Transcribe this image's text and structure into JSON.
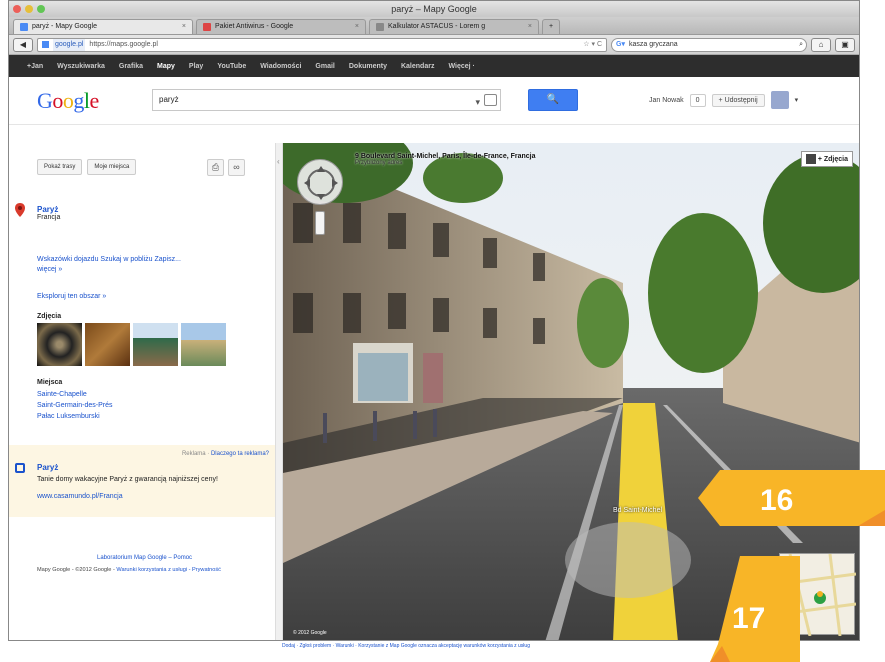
{
  "window": {
    "title": "paryż – Mapy Google"
  },
  "tabs": [
    {
      "label": "paryż - Mapy Google",
      "favicon_color": "#4a8af4",
      "active": true
    },
    {
      "label": "Pakiet Antiwirus - Google",
      "favicon_color": "#d44",
      "active": false
    },
    {
      "label": "Kalkulator ASTACUS - Lorem g",
      "favicon_color": "#888",
      "active": false
    }
  ],
  "urlbar": {
    "domain": "google.pl",
    "url": "https://maps.google.pl"
  },
  "browser_search": {
    "value": "kasza gryczana"
  },
  "gbar": {
    "items": [
      "+Jan",
      "Wyszukiwarka",
      "Grafika",
      "Mapy",
      "Play",
      "YouTube",
      "Wiadomości",
      "Gmail",
      "Dokumenty",
      "Kalendarz",
      "Więcej ·"
    ],
    "active_index": 3
  },
  "header": {
    "logo": "Google",
    "query": "paryż",
    "search_button": "🔍",
    "user": "Jan Nowak",
    "count": "0",
    "share": "+ Udostępnij"
  },
  "sidebar": {
    "buttons": {
      "directions": "Pokaż trasy",
      "my_places": "Moje miejsca"
    },
    "place": {
      "name": "Paryż",
      "country": "Francja"
    },
    "links": "Wskazówki dojazdu  Szukaj w pobliżu  Zapisz...  więcej »",
    "explore": "Eksploruj ten obszar »",
    "photos_label": "Zdjęcia",
    "places_label": "Miejsca",
    "places": [
      "Sainte-Chapelle",
      "Saint-Germain-des-Prés",
      "Pałac Luksemburski"
    ],
    "ad": {
      "hint_prefix": "Reklama · ",
      "hint_link": "Dlaczego ta reklama?",
      "title": "Paryż",
      "desc": "Tanie domy wakacyjne Paryż z gwarancją najniższej ceny!",
      "url": "www.casamundo.pl/Francja"
    },
    "footer1": "Laboratorium Map Google – Pomoc",
    "footer2_prefix": "Mapy Google - ©2012 Google - ",
    "footer2_link": "Warunki korzystania z usługi - Prywatność"
  },
  "streetview": {
    "address": "9 Boulevard Saint-Michel, Paris, Île-de-France, Francja",
    "address_sub": "Przybliżony adres",
    "photos_button": "+ Zdjęcia",
    "road_label": "Bd Saint-Michel",
    "copyright": "© 2012 Google",
    "tos": "Dodaj · Zgłoś problem · Warunki · Korzystanie z Map Google oznacza akceptację warunków korzystania z usług"
  },
  "callouts": [
    "16",
    "17"
  ],
  "colors": {
    "callout": "#f8b527",
    "callout_dark": "#f08f29",
    "link": "#1a52cc",
    "search_button": "#3f7ef2",
    "gbar": "#2d2d2d"
  }
}
